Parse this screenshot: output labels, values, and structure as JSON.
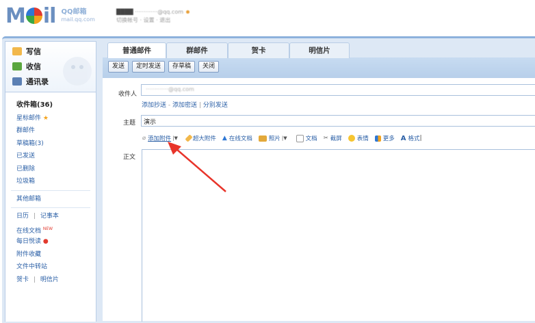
{
  "logo": {
    "sub_big": "QQ邮箱",
    "sub_small": "mail.qq.com"
  },
  "user": {
    "name": "████",
    "email": "·············@qq.com",
    "line2": "切换帐号 · 设置 · 退出"
  },
  "sidebar": {
    "compose": "写信",
    "inbox": "收信",
    "contacts": "通讯录",
    "folders": [
      {
        "label": "收件箱(36)",
        "bold": true
      },
      {
        "label": "星标邮件"
      },
      {
        "label": "群邮件"
      },
      {
        "label": "草稿箱(3)"
      },
      {
        "label": "已发送"
      },
      {
        "label": "已删除"
      },
      {
        "label": "垃圾箱"
      }
    ],
    "other_mailbox": "其他邮箱",
    "tools": {
      "calendar": "日历",
      "notes": "记事本",
      "online_docs": "在线文档",
      "new_tag": "NEW",
      "daily_read": "每日悦读",
      "attachment_fav": "附件收藏",
      "file_transfer": "文件中转站",
      "card": "贺卡",
      "postcard": "明信片",
      "divider": "|"
    }
  },
  "tabs": [
    "普通邮件",
    "群邮件",
    "贺卡",
    "明信片"
  ],
  "toolbar": {
    "send": "发送",
    "scheduled": "定时发送",
    "draft": "存草稿",
    "close": "关闭"
  },
  "form": {
    "to_label": "收件人",
    "to_value": "·············@qq.com",
    "cc_links": {
      "add_cc": "添加抄送",
      "dash": "-",
      "add_bcc": "添加密送",
      "pipe": "|",
      "separate": "分别发送"
    },
    "subject_label": "主题",
    "subject_value": "演示",
    "body_label": "正文"
  },
  "editbar": {
    "add_attachment": "添加附件",
    "big_attachment": "超大附件",
    "online_doc": "在线文档",
    "photo": "照片",
    "document": "文档",
    "screenshot": "截屏",
    "emoji": "表情",
    "more": "更多",
    "format": "格式"
  },
  "colors": {
    "arrow": "#e8342a",
    "frame": "#dde8f5",
    "link": "#2a5fa6"
  }
}
